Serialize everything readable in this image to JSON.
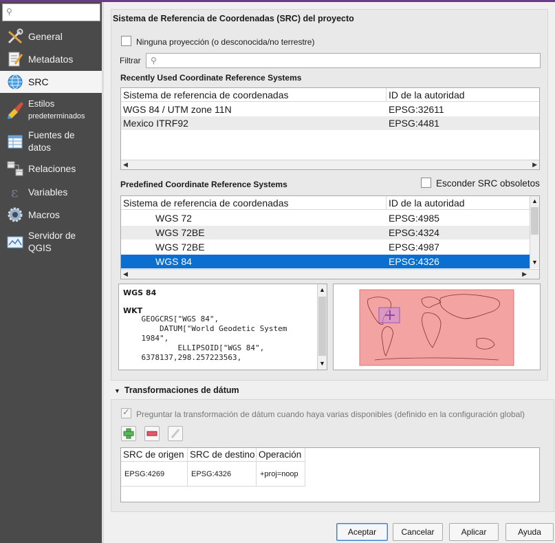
{
  "sidebar": {
    "search_placeholder": "",
    "items": [
      {
        "label": "General"
      },
      {
        "label": "Metadatos"
      },
      {
        "label": "SRC"
      },
      {
        "label_line1": "Estilos",
        "label_line2": "predeterminados"
      },
      {
        "label_line1": "Fuentes de",
        "label_line2": "datos"
      },
      {
        "label": "Relaciones"
      },
      {
        "label": "Variables"
      },
      {
        "label": "Macros"
      },
      {
        "label_line1": "Servidor de",
        "label_line2": "QGIS"
      }
    ]
  },
  "crs": {
    "section_title": "Sistema de Referencia de Coordenadas (SRC) del proyecto",
    "no_projection_label": "Ninguna proyección (o desconocida/no terrestre)",
    "filter_label": "Filtrar",
    "filter_value": "",
    "recent_title": "Recently Used Coordinate Reference Systems",
    "col_crs": "Sistema de referencia de coordenadas",
    "col_authority": "ID de la autoridad",
    "recent_rows": [
      {
        "name": "WGS 84 / UTM zone 11N",
        "id": "EPSG:32611"
      },
      {
        "name": "Mexico ITRF92",
        "id": "EPSG:4481"
      }
    ],
    "predefined_title": "Predefined Coordinate Reference Systems",
    "hide_deprecated_label": "Esconder SRC obsoletos",
    "predefined_rows": [
      {
        "name": "WGS 72",
        "id": "EPSG:4985"
      },
      {
        "name": "WGS 72BE",
        "id": "EPSG:4324"
      },
      {
        "name": "WGS 72BE",
        "id": "EPSG:4987"
      },
      {
        "name": "WGS 84",
        "id": "EPSG:4326"
      }
    ],
    "selected_index": 3,
    "wkt_title": "WGS 84",
    "wkt_label": "WKT",
    "wkt_text": "    GEOGCRS[\"WGS 84\",\n        DATUM[\"World Geodetic System\n    1984\",\n            ELLIPSOID[\"WGS 84\",\n    6378137,298.257223563,"
  },
  "datum": {
    "title": "Transformaciones de dátum",
    "ask_label": "Preguntar la transformación de dátum cuando haya varias disponibles (definido en la configuración global)",
    "col_source": "SRC de origen",
    "col_dest": "SRC de destino",
    "col_operation": "Operación",
    "rows": [
      {
        "source": "EPSG:4269",
        "dest": "EPSG:4326",
        "operation": "+proj=noop"
      }
    ]
  },
  "buttons": {
    "accept": "Aceptar",
    "cancel": "Cancelar",
    "apply": "Aplicar",
    "help": "Ayuda"
  },
  "colors": {
    "accent_selection": "#0a6fcf",
    "sidebar_bg": "#4a4a4a",
    "map_extent": "#f4a3a3"
  }
}
